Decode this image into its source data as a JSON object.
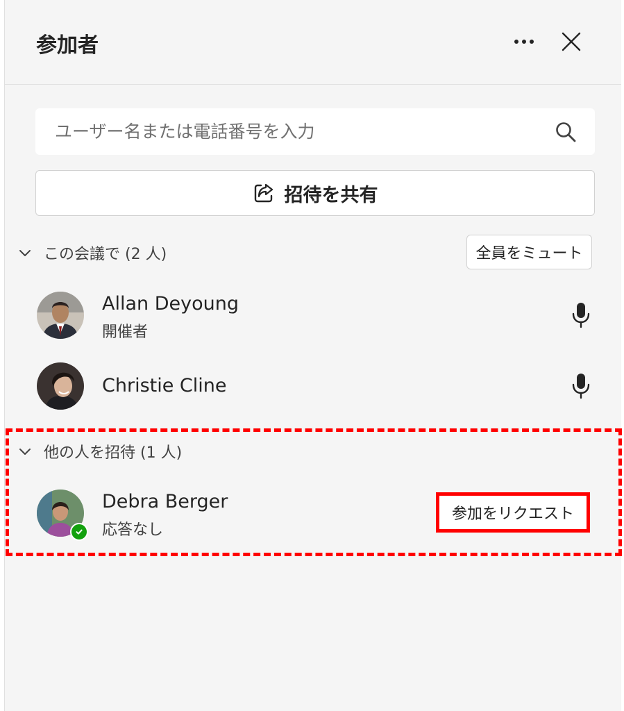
{
  "panel": {
    "title": "参加者",
    "more_icon": "more-horizontal-icon",
    "close_icon": "close-icon"
  },
  "search": {
    "placeholder": "ユーザー名または電話番号を入力",
    "icon": "search-icon"
  },
  "share_invite": {
    "label": "招待を共有",
    "icon": "share-icon"
  },
  "in_meeting": {
    "header": "この会議で (2 人)",
    "mute_all_label": "全員をミュート",
    "people": [
      {
        "name": "Allan Deyoung",
        "role": "開催者",
        "mic_icon": "microphone-icon"
      },
      {
        "name": "Christie Cline",
        "role": "",
        "mic_icon": "microphone-icon"
      }
    ]
  },
  "invite_others": {
    "header": "他の人を招待 (1 人)",
    "people": [
      {
        "name": "Debra Berger",
        "status": "応答なし",
        "presence": "available",
        "action_label": "参加をリクエスト"
      }
    ]
  },
  "colors": {
    "panel_bg": "#f5f5f5",
    "highlight": "#ff0000",
    "presence_available": "#13a10e"
  }
}
